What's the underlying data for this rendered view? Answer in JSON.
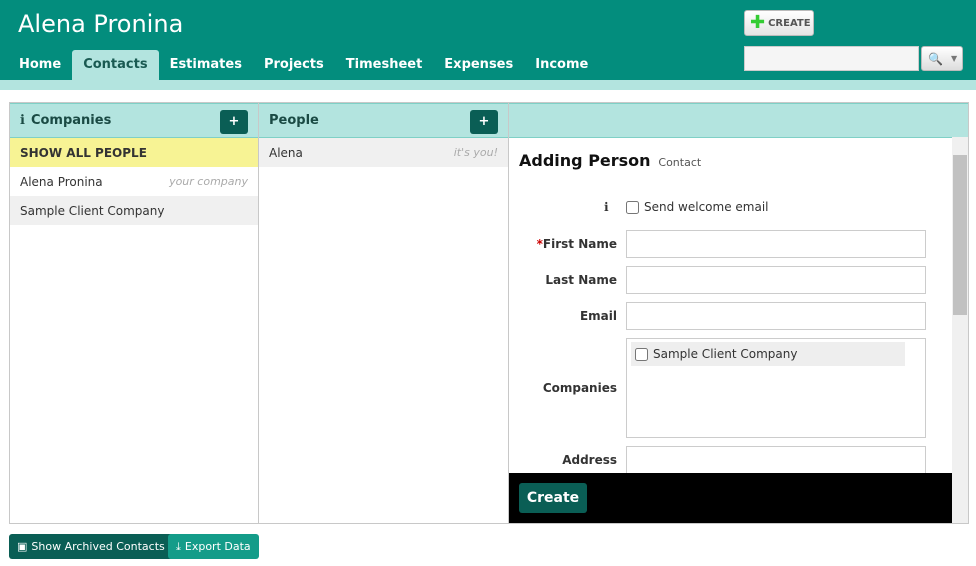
{
  "app": {
    "title": "Alena Pronina",
    "create_label": "CREATE"
  },
  "nav": [
    "Home",
    "Contacts",
    "Estimates",
    "Projects",
    "Timesheet",
    "Expenses",
    "Income"
  ],
  "search": {
    "value": ""
  },
  "companies": {
    "title": "Companies",
    "show_all": "SHOW ALL PEOPLE",
    "items": [
      {
        "name": "Alena Pronina",
        "hint": "your company"
      },
      {
        "name": "Sample Client Company",
        "hint": ""
      }
    ]
  },
  "people": {
    "title": "People",
    "items": [
      {
        "name": "Alena",
        "hint": "it's you!"
      }
    ]
  },
  "form": {
    "title": "Adding Person",
    "subtitle": "Contact",
    "welcome": "Send welcome email",
    "first_name": "First Name",
    "required_mark": "*",
    "last_name": "Last Name",
    "email": "Email",
    "companies": "Companies",
    "company_option": "Sample Client Company",
    "address": "Address",
    "submit": "Create"
  },
  "footer": {
    "archived": "Show Archived Contacts",
    "export": "Export Data"
  }
}
